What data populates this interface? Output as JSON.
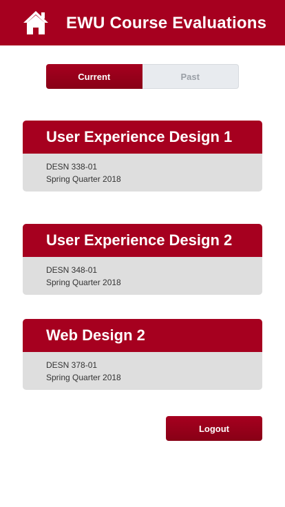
{
  "header": {
    "title": "EWU Course Evaluations",
    "home_icon": "home-icon"
  },
  "tabs": [
    {
      "label": "Current",
      "active": true
    },
    {
      "label": "Past",
      "active": false
    }
  ],
  "courses": [
    {
      "title": "User Experience Design 1",
      "code": "DESN 338-01",
      "term": "Spring Quarter 2018"
    },
    {
      "title": "User Experience Design 2",
      "code": "DESN 348-01",
      "term": "Spring Quarter 2018"
    },
    {
      "title": "Web Design 2",
      "code": "DESN 378-01",
      "term": "Spring Quarter 2018"
    }
  ],
  "logout_label": "Logout",
  "colors": {
    "brand": "#a6001f",
    "card_body": "#dedede",
    "inactive_tab": "#e8ebef"
  }
}
